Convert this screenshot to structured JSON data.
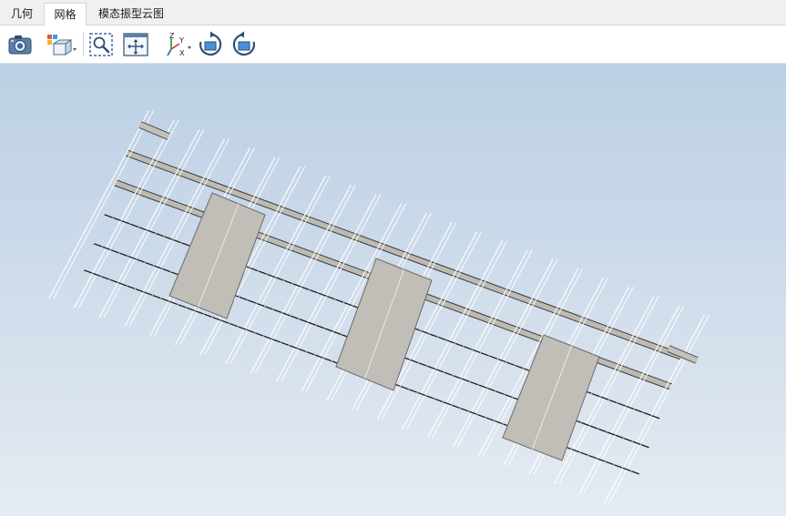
{
  "tabs": [
    {
      "label": "几何",
      "active": false
    },
    {
      "label": "网格",
      "active": true
    },
    {
      "label": "模态振型云图",
      "active": false
    }
  ],
  "toolbar": {
    "buttons": [
      {
        "icon": "camera-icon"
      },
      {
        "icon": "view-cube-dropdown-icon"
      },
      {
        "icon": "zoom-window-icon"
      },
      {
        "icon": "fit-all-icon"
      },
      {
        "icon": "axis-orientation-dropdown-icon"
      },
      {
        "icon": "rotate-clockwise-icon"
      },
      {
        "icon": "rotate-counterclockwise-icon"
      }
    ],
    "axis_labels": {
      "z": "Z",
      "y": "Y",
      "x": "X"
    }
  },
  "viewport": {
    "background_top": "#bcd0e4",
    "background_bottom": "#e5ebf2",
    "mesh_line_color": "#ffffff",
    "edge_line_color": "#1e1e1e",
    "panel_fill": "#c1bdb7"
  }
}
